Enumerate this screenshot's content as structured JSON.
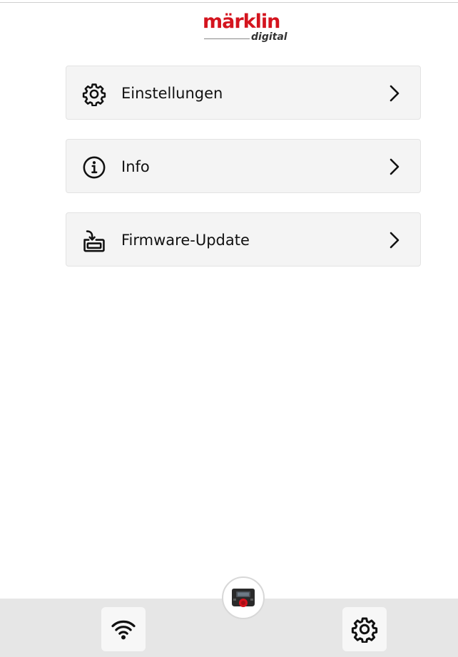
{
  "header": {
    "logo_brand": "märklin",
    "logo_sub": "digital"
  },
  "menu": [
    {
      "label": "Einstellungen",
      "icon": "gear-icon"
    },
    {
      "label": "Info",
      "icon": "info-icon"
    },
    {
      "label": "Firmware-Update",
      "icon": "firmware-update-icon"
    }
  ],
  "bottom_bar": {
    "left_icon": "wifi-icon",
    "center_icon": "central-station-device-icon",
    "right_icon": "gear-icon"
  },
  "colors": {
    "brand_red": "#d4141e",
    "item_background": "#f4f4f4",
    "bottom_bar": "#e6e6e6"
  }
}
